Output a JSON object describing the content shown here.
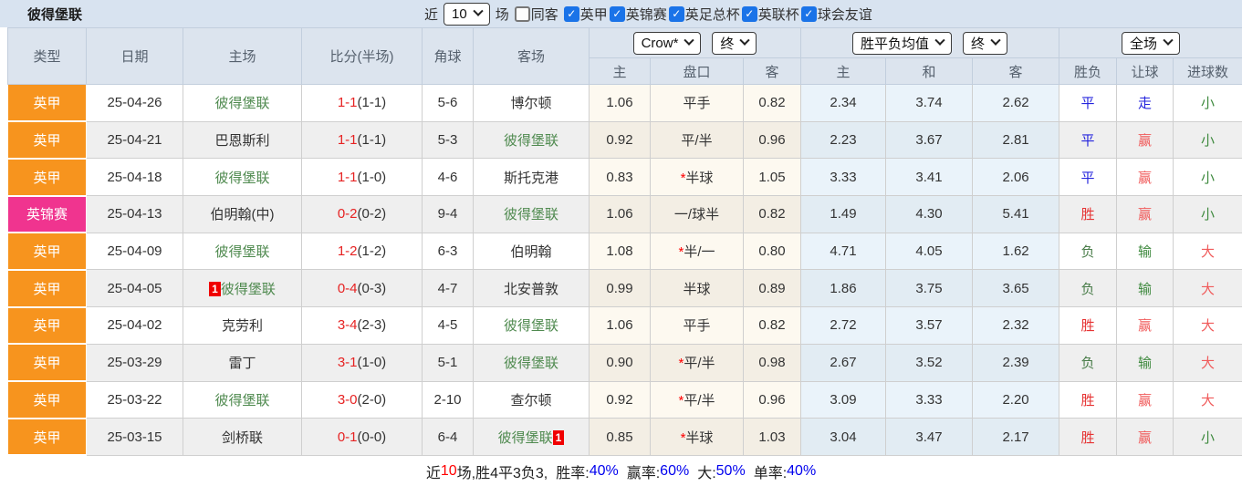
{
  "topbar": {
    "team_title": "彼得堡联",
    "near_label": "近",
    "matches_select_value": "10",
    "matches_label": "场",
    "same_opponent": {
      "label": "同客",
      "checked": false
    },
    "leagues": [
      {
        "label": "英甲",
        "checked": true
      },
      {
        "label": "英锦赛",
        "checked": true
      },
      {
        "label": "英足总杯",
        "checked": true
      },
      {
        "label": "英联杯",
        "checked": true
      },
      {
        "label": "球会友谊",
        "checked": true
      }
    ]
  },
  "table": {
    "headers": {
      "type": "类型",
      "date": "日期",
      "home": "主场",
      "score": "比分(半场)",
      "corner": "角球",
      "away": "客场",
      "ah_home": "主",
      "ah_line": "盘口",
      "ah_away": "客",
      "eu_home": "主",
      "eu_draw": "和",
      "eu_away": "客",
      "res_wdl": "胜负",
      "res_ah": "让球",
      "res_goal": "进球数",
      "bookmaker_select_value": "Crow*",
      "ah_time_select_value": "终",
      "eu_average_select_value": "胜平负均值",
      "eu_time_select_value": "终",
      "scope_select_value": "全场"
    },
    "rows": [
      {
        "type": "英甲",
        "type_class": "league-orange",
        "date": "25-04-26",
        "home": "彼得堡联",
        "home_class": "team-green",
        "home_badge": "",
        "score_ft": "1-1",
        "score_ht": "(1-1)",
        "corners": "5-6",
        "away": "博尔顿",
        "away_class": "",
        "away_badge": "",
        "ah_home": "1.06",
        "ah_star": "",
        "ah_line": "平手",
        "ah_away": "0.82",
        "eu_home": "2.34",
        "eu_draw": "3.74",
        "eu_away": "2.62",
        "res_wdl": "平",
        "res_wdl_class": "c-blue",
        "res_ah": "走",
        "res_ah_class": "c-blue",
        "res_goal": "小",
        "res_goal_class": "c-green2"
      },
      {
        "type": "英甲",
        "type_class": "league-orange",
        "date": "25-04-21",
        "home": "巴恩斯利",
        "home_class": "",
        "home_badge": "",
        "score_ft": "1-1",
        "score_ht": "(1-1)",
        "corners": "5-3",
        "away": "彼得堡联",
        "away_class": "team-green",
        "away_badge": "",
        "ah_home": "0.92",
        "ah_star": "",
        "ah_line": "平/半",
        "ah_away": "0.96",
        "eu_home": "2.23",
        "eu_draw": "3.67",
        "eu_away": "2.81",
        "res_wdl": "平",
        "res_wdl_class": "c-blue",
        "res_ah": "赢",
        "res_ah_class": "c-red2",
        "res_goal": "小",
        "res_goal_class": "c-green2"
      },
      {
        "type": "英甲",
        "type_class": "league-orange",
        "date": "25-04-18",
        "home": "彼得堡联",
        "home_class": "team-green",
        "home_badge": "",
        "score_ft": "1-1",
        "score_ht": "(1-0)",
        "corners": "4-6",
        "away": "斯托克港",
        "away_class": "",
        "away_badge": "",
        "ah_home": "0.83",
        "ah_star": "*",
        "ah_line": "半球",
        "ah_away": "1.05",
        "eu_home": "3.33",
        "eu_draw": "3.41",
        "eu_away": "2.06",
        "res_wdl": "平",
        "res_wdl_class": "c-blue",
        "res_ah": "赢",
        "res_ah_class": "c-red2",
        "res_goal": "小",
        "res_goal_class": "c-green2"
      },
      {
        "type": "英锦赛",
        "type_class": "league-magenta",
        "date": "25-04-13",
        "home": "伯明翰(中)",
        "home_class": "",
        "home_badge": "",
        "score_ft": "0-2",
        "score_ht": "(0-2)",
        "corners": "9-4",
        "away": "彼得堡联",
        "away_class": "team-green",
        "away_badge": "",
        "ah_home": "1.06",
        "ah_star": "",
        "ah_line": "一/球半",
        "ah_away": "0.82",
        "eu_home": "1.49",
        "eu_draw": "4.30",
        "eu_away": "5.41",
        "res_wdl": "胜",
        "res_wdl_class": "c-red",
        "res_ah": "赢",
        "res_ah_class": "c-red2",
        "res_goal": "小",
        "res_goal_class": "c-green2"
      },
      {
        "type": "英甲",
        "type_class": "league-orange",
        "date": "25-04-09",
        "home": "彼得堡联",
        "home_class": "team-green",
        "home_badge": "",
        "score_ft": "1-2",
        "score_ht": "(1-2)",
        "corners": "6-3",
        "away": "伯明翰",
        "away_class": "",
        "away_badge": "",
        "ah_home": "1.08",
        "ah_star": "*",
        "ah_line": "半/一",
        "ah_away": "0.80",
        "eu_home": "4.71",
        "eu_draw": "4.05",
        "eu_away": "1.62",
        "res_wdl": "负",
        "res_wdl_class": "c-green",
        "res_ah": "输",
        "res_ah_class": "c-green2",
        "res_goal": "大",
        "res_goal_class": "c-red2"
      },
      {
        "type": "英甲",
        "type_class": "league-orange",
        "date": "25-04-05",
        "home": "彼得堡联",
        "home_class": "team-green",
        "home_badge": "1",
        "score_ft": "0-4",
        "score_ht": "(0-3)",
        "corners": "4-7",
        "away": "北安普敦",
        "away_class": "",
        "away_badge": "",
        "ah_home": "0.99",
        "ah_star": "",
        "ah_line": "半球",
        "ah_away": "0.89",
        "eu_home": "1.86",
        "eu_draw": "3.75",
        "eu_away": "3.65",
        "res_wdl": "负",
        "res_wdl_class": "c-green",
        "res_ah": "输",
        "res_ah_class": "c-green2",
        "res_goal": "大",
        "res_goal_class": "c-red2"
      },
      {
        "type": "英甲",
        "type_class": "league-orange",
        "date": "25-04-02",
        "home": "克劳利",
        "home_class": "",
        "home_badge": "",
        "score_ft": "3-4",
        "score_ht": "(2-3)",
        "corners": "4-5",
        "away": "彼得堡联",
        "away_class": "team-green",
        "away_badge": "",
        "ah_home": "1.06",
        "ah_star": "",
        "ah_line": "平手",
        "ah_away": "0.82",
        "eu_home": "2.72",
        "eu_draw": "3.57",
        "eu_away": "2.32",
        "res_wdl": "胜",
        "res_wdl_class": "c-red",
        "res_ah": "赢",
        "res_ah_class": "c-red2",
        "res_goal": "大",
        "res_goal_class": "c-red2"
      },
      {
        "type": "英甲",
        "type_class": "league-orange",
        "date": "25-03-29",
        "home": "雷丁",
        "home_class": "",
        "home_badge": "",
        "score_ft": "3-1",
        "score_ht": "(1-0)",
        "corners": "5-1",
        "away": "彼得堡联",
        "away_class": "team-green",
        "away_badge": "",
        "ah_home": "0.90",
        "ah_star": "*",
        "ah_line": "平/半",
        "ah_away": "0.98",
        "eu_home": "2.67",
        "eu_draw": "3.52",
        "eu_away": "2.39",
        "res_wdl": "负",
        "res_wdl_class": "c-green",
        "res_ah": "输",
        "res_ah_class": "c-green2",
        "res_goal": "大",
        "res_goal_class": "c-red2"
      },
      {
        "type": "英甲",
        "type_class": "league-orange",
        "date": "25-03-22",
        "home": "彼得堡联",
        "home_class": "team-green",
        "home_badge": "",
        "score_ft": "3-0",
        "score_ht": "(2-0)",
        "corners": "2-10",
        "away": "查尔顿",
        "away_class": "",
        "away_badge": "",
        "ah_home": "0.92",
        "ah_star": "*",
        "ah_line": "平/半",
        "ah_away": "0.96",
        "eu_home": "3.09",
        "eu_draw": "3.33",
        "eu_away": "2.20",
        "res_wdl": "胜",
        "res_wdl_class": "c-red",
        "res_ah": "赢",
        "res_ah_class": "c-red2",
        "res_goal": "大",
        "res_goal_class": "c-red2"
      },
      {
        "type": "英甲",
        "type_class": "league-orange",
        "date": "25-03-15",
        "home": "剑桥联",
        "home_class": "",
        "home_badge": "",
        "score_ft": "0-1",
        "score_ht": "(0-0)",
        "corners": "6-4",
        "away": "彼得堡联",
        "away_class": "team-green",
        "away_badge": "1",
        "ah_home": "0.85",
        "ah_star": "*",
        "ah_line": "半球",
        "ah_away": "1.03",
        "eu_home": "3.04",
        "eu_draw": "3.47",
        "eu_away": "2.17",
        "res_wdl": "胜",
        "res_wdl_class": "c-red",
        "res_ah": "赢",
        "res_ah_class": "c-red2",
        "res_goal": "小",
        "res_goal_class": "c-green2"
      }
    ]
  },
  "summary": {
    "prefix": "近",
    "count": "10",
    "middle": "场,胜4平3负3,",
    "stats": [
      {
        "label": "胜率:",
        "value": "40%"
      },
      {
        "label": "赢率:",
        "value": "60%"
      },
      {
        "label": "大:",
        "value": "50%"
      },
      {
        "label": "单率:",
        "value": "40%"
      }
    ]
  },
  "colors": {
    "league_orange": "#F7941E",
    "league_magenta": "#F0348F",
    "team_green": "#4F8A4F",
    "score_red": "#E62222",
    "win_red": "#E63333",
    "lose_green": "#4A7D4A",
    "draw_blue": "#2525DD",
    "percent_blue": "#0000EE",
    "topbar_bg": "#D8E3F0",
    "header_bg": "#DCE4EE",
    "checkbox_blue": "#1A73E8"
  }
}
